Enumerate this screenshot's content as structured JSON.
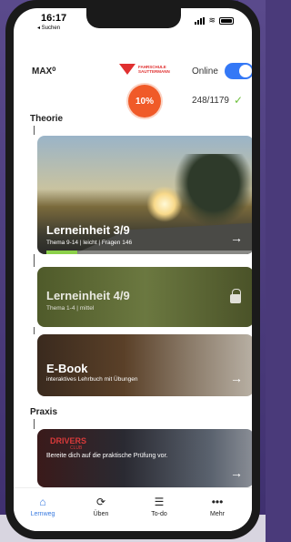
{
  "status": {
    "time": "16:17",
    "back_app": "◂ Suchen"
  },
  "header": {
    "brand_label": "MAX⁰",
    "logo_text": "FAHRSCHULE SAUTTERMANN",
    "online_label": "Online",
    "online_on": true
  },
  "progress": {
    "percent_label": "10%",
    "count": "248/1179",
    "check": "✓"
  },
  "sections": {
    "theory": "Theorie",
    "practice": "Praxis"
  },
  "cards": [
    {
      "title": "Lerneinheit 3/9",
      "subtitle": "Thema 9-14 | leicht | Fragen 146",
      "arrow": "→",
      "progress": 0.15
    },
    {
      "title": "Lerneinheit 4/9",
      "subtitle": "Thema 1-4 | mittel",
      "locked": true
    },
    {
      "title": "E-Book",
      "subtitle": "interaktives Lehrbuch mit Übungen",
      "arrow": "→"
    },
    {
      "brand": "DRIVERS",
      "brand_sub": "CLUB",
      "subtitle": "Bereite dich auf die praktische Prüfung vor.",
      "arrow": "→"
    }
  ],
  "tabs": [
    {
      "label": "Lernweg",
      "icon": "⌂",
      "active": true
    },
    {
      "label": "Üben",
      "icon": "⟳"
    },
    {
      "label": "To-do",
      "icon": "☰"
    },
    {
      "label": "Mehr",
      "icon": "•••"
    }
  ]
}
